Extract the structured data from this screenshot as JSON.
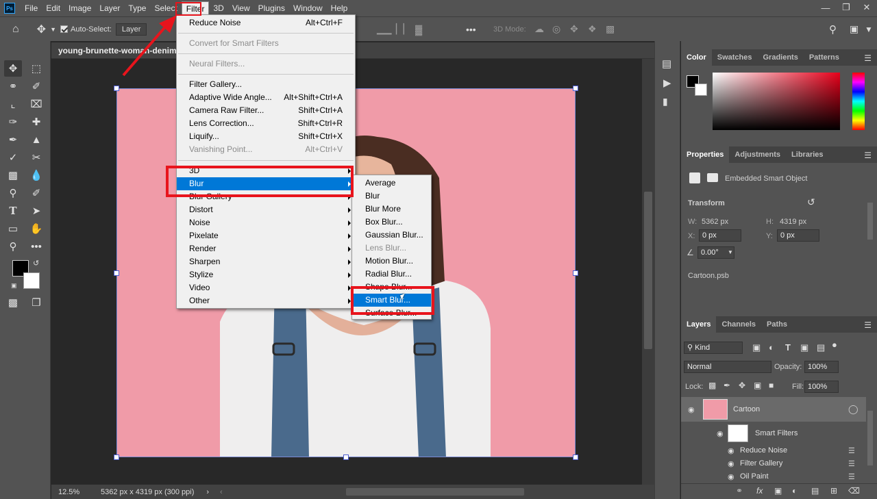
{
  "app": {
    "logo": "Ps"
  },
  "menubar": {
    "items": [
      "File",
      "Edit",
      "Image",
      "Layer",
      "Type",
      "Select",
      "Filter",
      "3D",
      "View",
      "Plugins",
      "Window",
      "Help"
    ],
    "active": "Filter"
  },
  "options": {
    "auto_select_label": "Auto-Select:",
    "auto_select_value": "Layer",
    "mode_3d_label": "3D Mode:"
  },
  "document": {
    "tab_title": "young-brunette-woman-denim-c",
    "zoom": "12.5%",
    "dimensions": "5362 px x 4319 px (300 ppi)"
  },
  "filter_menu": {
    "items": [
      {
        "label": "Reduce Noise",
        "shortcut": "Alt+Ctrl+F"
      },
      {
        "label": "Convert for Smart Filters",
        "disabled": true
      },
      {
        "label": "Neural Filters...",
        "disabled": true
      },
      {
        "label": "Filter Gallery..."
      },
      {
        "label": "Adaptive Wide Angle...",
        "shortcut": "Alt+Shift+Ctrl+A"
      },
      {
        "label": "Camera Raw Filter...",
        "shortcut": "Shift+Ctrl+A"
      },
      {
        "label": "Lens Correction...",
        "shortcut": "Shift+Ctrl+R"
      },
      {
        "label": "Liquify...",
        "shortcut": "Shift+Ctrl+X"
      },
      {
        "label": "Vanishing Point...",
        "shortcut": "Alt+Ctrl+V",
        "disabled": true
      },
      {
        "label": "3D"
      },
      {
        "label": "Blur",
        "highlighted": true
      },
      {
        "label": "Blur Gallery"
      },
      {
        "label": "Distort"
      },
      {
        "label": "Noise"
      },
      {
        "label": "Pixelate"
      },
      {
        "label": "Render"
      },
      {
        "label": "Sharpen"
      },
      {
        "label": "Stylize"
      },
      {
        "label": "Video"
      },
      {
        "label": "Other"
      }
    ]
  },
  "blur_menu": {
    "items": [
      {
        "label": "Average"
      },
      {
        "label": "Blur"
      },
      {
        "label": "Blur More"
      },
      {
        "label": "Box Blur..."
      },
      {
        "label": "Gaussian Blur..."
      },
      {
        "label": "Lens Blur...",
        "disabled": true
      },
      {
        "label": "Motion Blur..."
      },
      {
        "label": "Radial Blur..."
      },
      {
        "label": "Shape Blur..."
      },
      {
        "label": "Smart Blur...",
        "highlighted": true
      },
      {
        "label": "Surface Blur..."
      }
    ]
  },
  "color_panel": {
    "tabs": [
      "Color",
      "Swatches",
      "Gradients",
      "Patterns"
    ]
  },
  "properties_panel": {
    "tabs": [
      "Properties",
      "Adjustments",
      "Libraries"
    ],
    "type": "Embedded Smart Object",
    "transform_label": "Transform",
    "w_label": "W:",
    "w_value": "5362 px",
    "h_label": "H:",
    "h_value": "4319 px",
    "x_label": "X:",
    "x_value": "0 px",
    "y_label": "Y:",
    "y_value": "0 px",
    "angle_value": "0.00°",
    "filename": "Cartoon.psb"
  },
  "layers_panel": {
    "tabs": [
      "Layers",
      "Channels",
      "Paths"
    ],
    "kind_label": "Kind",
    "blend_mode": "Normal",
    "opacity_label": "Opacity:",
    "opacity_value": "100%",
    "lock_label": "Lock:",
    "fill_label": "Fill:",
    "fill_value": "100%",
    "layer_name": "Cartoon",
    "smart_filters_label": "Smart Filters",
    "filters": [
      "Reduce Noise",
      "Filter Gallery",
      "Oil Paint"
    ]
  },
  "colors": {
    "accent": "#0078d7",
    "highlight_box": "#e8141c",
    "canvas_pink": "#f09ba8"
  }
}
